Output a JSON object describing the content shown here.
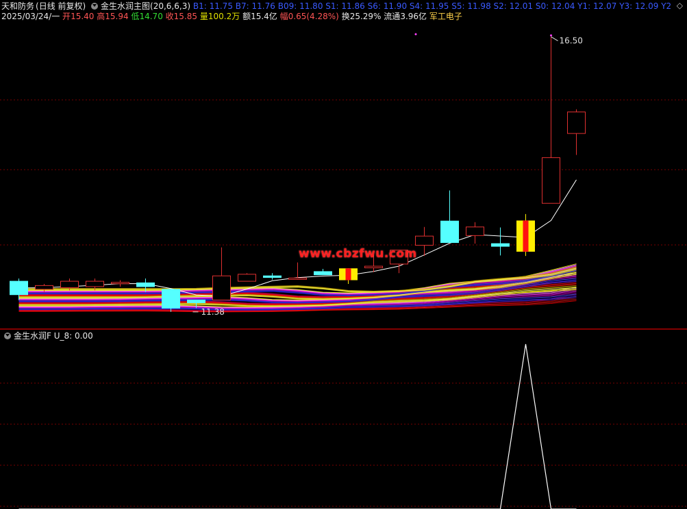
{
  "header": {
    "stock_name": "天和防务",
    "period": "(日线 前复权)",
    "indicator_name": "金生水润主图(20,6,6,3)",
    "levels": [
      {
        "label": "B1:",
        "value": "11.75"
      },
      {
        "label": "B7:",
        "value": "11.76"
      },
      {
        "label": "B09:",
        "value": "11.80"
      },
      {
        "label": "S1:",
        "value": "11.86"
      },
      {
        "label": "S6:",
        "value": "11.90"
      },
      {
        "label": "S4:",
        "value": "11.95"
      },
      {
        "label": "S5:",
        "value": "11.98"
      },
      {
        "label": "S2:",
        "value": "12.01"
      },
      {
        "label": "S0:",
        "value": "12.04"
      },
      {
        "label": "Y1:",
        "value": "12.07"
      },
      {
        "label": "Y3:",
        "value": "12.09"
      },
      {
        "label": "Y2",
        "value": ""
      }
    ]
  },
  "quote": {
    "date": "2025/03/24/一",
    "open_label": "开",
    "open": "15.40",
    "high_label": "高",
    "high": "15.94",
    "low_label": "低",
    "low": "14.70",
    "close_label": "收",
    "close": "15.85",
    "volume_label": "量",
    "volume": "100.2万",
    "amount_label": "额",
    "amount": "15.4亿",
    "change_label": "幅",
    "change": "0.65(4.28%)",
    "turnover_label": "换",
    "turnover": "25.29%",
    "float_label": "流通",
    "float": "3.96亿",
    "sector": "军工电子"
  },
  "chart_annotations": {
    "high_label": "16.50",
    "low_label": "11.38"
  },
  "watermark": "www.cbzfwu.com",
  "sub_indicator": {
    "name": "金生水润F",
    "value_label": "U_8:",
    "value": "0.00"
  },
  "colors": {
    "background": "#000000",
    "up_candle": "#e03030",
    "down_candle": "#55ffff",
    "grid": "#7a0000",
    "signal_fill": "#ffee00",
    "signal_stripe": "#ff1010"
  },
  "chart_data": {
    "type": "candlestick",
    "y_range": [
      11.2,
      16.7
    ],
    "candles": [
      {
        "o": 11.95,
        "h": 12.0,
        "l": 11.6,
        "c": 11.7
      },
      {
        "o": 11.8,
        "h": 11.9,
        "l": 11.75,
        "c": 11.87
      },
      {
        "o": 11.83,
        "h": 12.0,
        "l": 11.78,
        "c": 11.95
      },
      {
        "o": 11.85,
        "h": 12.0,
        "l": 11.78,
        "c": 11.95
      },
      {
        "o": 11.93,
        "h": 11.97,
        "l": 11.85,
        "c": 11.93
      },
      {
        "o": 11.92,
        "h": 12.0,
        "l": 11.75,
        "c": 11.85
      },
      {
        "o": 11.8,
        "h": 11.8,
        "l": 11.38,
        "c": 11.45
      },
      {
        "o": 11.6,
        "h": 11.6,
        "l": 11.45,
        "c": 11.55
      },
      {
        "o": 11.6,
        "h": 12.58,
        "l": 11.6,
        "c": 12.05
      },
      {
        "o": 11.95,
        "h": 12.1,
        "l": 11.95,
        "c": 12.08
      },
      {
        "o": 12.05,
        "h": 12.1,
        "l": 11.98,
        "c": 12.02
      },
      {
        "o": 12.0,
        "h": 12.3,
        "l": 11.98,
        "c": 12.01
      },
      {
        "o": 12.13,
        "h": 12.18,
        "l": 12.1,
        "c": 12.07
      },
      {
        "o": 11.97,
        "h": 12.19,
        "l": 11.9,
        "c": 12.19
      },
      {
        "o": 12.2,
        "h": 12.45,
        "l": 12.12,
        "c": 12.23
      },
      {
        "o": 12.27,
        "h": 12.53,
        "l": 12.1,
        "c": 12.53
      },
      {
        "o": 12.62,
        "h": 12.96,
        "l": 12.42,
        "c": 12.79
      },
      {
        "o": 13.07,
        "h": 13.64,
        "l": 12.7,
        "c": 12.67
      },
      {
        "o": 12.8,
        "h": 13.05,
        "l": 12.65,
        "c": 12.96
      },
      {
        "o": 12.65,
        "h": 12.95,
        "l": 12.43,
        "c": 12.6
      },
      {
        "o": 12.5,
        "h": 13.2,
        "l": 12.42,
        "c": 13.08
      },
      {
        "o": 13.4,
        "h": 16.5,
        "l": 13.4,
        "c": 14.25
      },
      {
        "o": 14.7,
        "h": 15.15,
        "l": 14.3,
        "c": 15.1
      }
    ],
    "signal_candle_indices": [
      13,
      20
    ],
    "sub_series": {
      "name": "U_8",
      "values": [
        0,
        0,
        0,
        0,
        0,
        0,
        0,
        0,
        0,
        0,
        0,
        0,
        0,
        0,
        0,
        0,
        0,
        0,
        0,
        0,
        1,
        0,
        0
      ]
    }
  }
}
